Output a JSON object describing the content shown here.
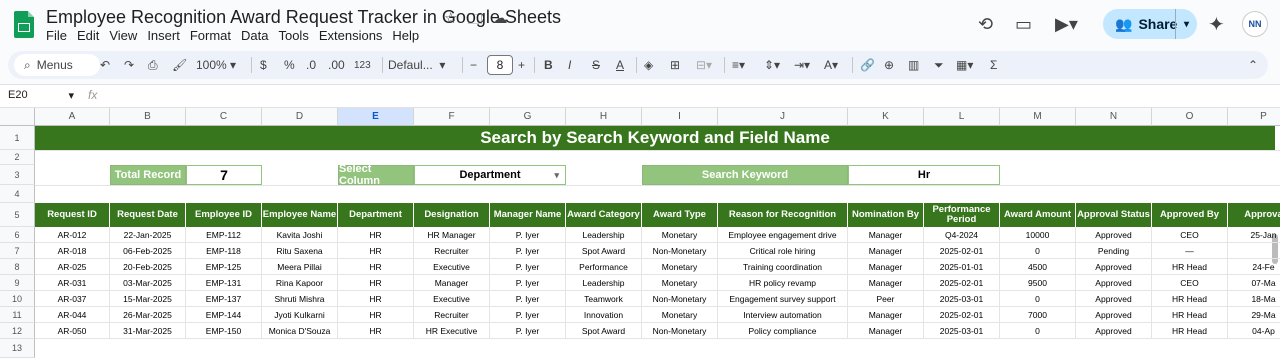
{
  "app": {
    "title": "Employee Recognition Award Request Tracker in Google Sheets",
    "menus": [
      "File",
      "Edit",
      "View",
      "Insert",
      "Format",
      "Data",
      "Tools",
      "Extensions",
      "Help"
    ],
    "share_label": "Share",
    "avatar_text": "NN"
  },
  "toolbar": {
    "menus_label": "Menus",
    "zoom": "100%",
    "currency": "$",
    "percent": "%",
    "dec_decrease": ".0",
    "dec_increase": ".00",
    "number_format": "123",
    "font": "Defaul...",
    "font_size": "8"
  },
  "formula_bar": {
    "cell_ref": "E20",
    "fx": "fx",
    "content": ""
  },
  "columns": [
    "A",
    "B",
    "C",
    "D",
    "E",
    "F",
    "G",
    "H",
    "I",
    "J",
    "K",
    "L",
    "M",
    "N",
    "O",
    "P"
  ],
  "selected_column": "E",
  "rows": [
    "1",
    "2",
    "3",
    "4",
    "5",
    "6",
    "7",
    "8",
    "9",
    "10",
    "11",
    "12",
    "13"
  ],
  "sheet": {
    "banner": "Search by Search Keyword and Field Name",
    "total_record_label": "Total Record",
    "total_record_value": "7",
    "select_column_label": "Select Column",
    "select_column_value": "Department",
    "search_keyword_label": "Search Keyword",
    "search_keyword_value": "Hr",
    "headers": [
      "Request ID",
      "Request Date",
      "Employee ID",
      "Employee Name",
      "Department",
      "Designation",
      "Manager Name",
      "Award Category",
      "Award Type",
      "Reason for Recognition",
      "Nomination By",
      "Performance Period",
      "Award Amount",
      "Approval Status",
      "Approved By",
      "Approva"
    ],
    "data": [
      [
        "AR-012",
        "22-Jan-2025",
        "EMP-112",
        "Kavita Joshi",
        "HR",
        "HR Manager",
        "P. Iyer",
        "Leadership",
        "Monetary",
        "Employee engagement drive",
        "Manager",
        "Q4-2024",
        "10000",
        "Approved",
        "CEO",
        "25-Jan"
      ],
      [
        "AR-018",
        "06-Feb-2025",
        "EMP-118",
        "Ritu Saxena",
        "HR",
        "Recruiter",
        "P. Iyer",
        "Spot Award",
        "Non-Monetary",
        "Critical role hiring",
        "Manager",
        "2025-02-01",
        "0",
        "Pending",
        "—",
        ""
      ],
      [
        "AR-025",
        "20-Feb-2025",
        "EMP-125",
        "Meera Pillai",
        "HR",
        "Executive",
        "P. Iyer",
        "Performance",
        "Monetary",
        "Training coordination",
        "Manager",
        "2025-01-01",
        "4500",
        "Approved",
        "HR Head",
        "24-Fe"
      ],
      [
        "AR-031",
        "03-Mar-2025",
        "EMP-131",
        "Rina Kapoor",
        "HR",
        "Manager",
        "P. Iyer",
        "Leadership",
        "Monetary",
        "HR policy revamp",
        "Manager",
        "2025-02-01",
        "9500",
        "Approved",
        "CEO",
        "07-Ma"
      ],
      [
        "AR-037",
        "15-Mar-2025",
        "EMP-137",
        "Shruti Mishra",
        "HR",
        "Executive",
        "P. Iyer",
        "Teamwork",
        "Non-Monetary",
        "Engagement survey support",
        "Peer",
        "2025-03-01",
        "0",
        "Approved",
        "HR Head",
        "18-Ma"
      ],
      [
        "AR-044",
        "26-Mar-2025",
        "EMP-144",
        "Jyoti Kulkarni",
        "HR",
        "Recruiter",
        "P. Iyer",
        "Innovation",
        "Monetary",
        "Interview automation",
        "Manager",
        "2025-02-01",
        "7000",
        "Approved",
        "HR Head",
        "29-Ma"
      ],
      [
        "AR-050",
        "31-Mar-2025",
        "EMP-150",
        "Monica D'Souza",
        "HR",
        "HR Executive",
        "P. Iyer",
        "Spot Award",
        "Non-Monetary",
        "Policy compliance",
        "Manager",
        "2025-03-01",
        "0",
        "Approved",
        "HR Head",
        "04-Ap"
      ]
    ]
  },
  "colors": {
    "header_green": "#38761d",
    "label_green": "#93c47d"
  }
}
